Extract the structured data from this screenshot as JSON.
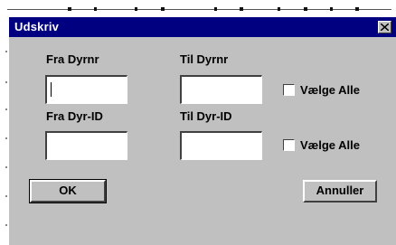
{
  "dialog": {
    "title": "Udskriv",
    "close_icon": "close-icon"
  },
  "from_number": {
    "label": "Fra Dyrnr",
    "value": ""
  },
  "to_number": {
    "label": "Til Dyrnr",
    "value": ""
  },
  "select_all_number": {
    "label": "Vælge Alle",
    "checked": false
  },
  "from_id": {
    "label": "Fra Dyr-ID",
    "value": ""
  },
  "to_id": {
    "label": "Til Dyr-ID",
    "value": ""
  },
  "select_all_id": {
    "label": "Vælge Alle",
    "checked": false
  },
  "buttons": {
    "ok": "OK",
    "cancel": "Annuller"
  },
  "colors": {
    "titlebar": "#000080",
    "dialog_bg": "#c0c0c0"
  }
}
